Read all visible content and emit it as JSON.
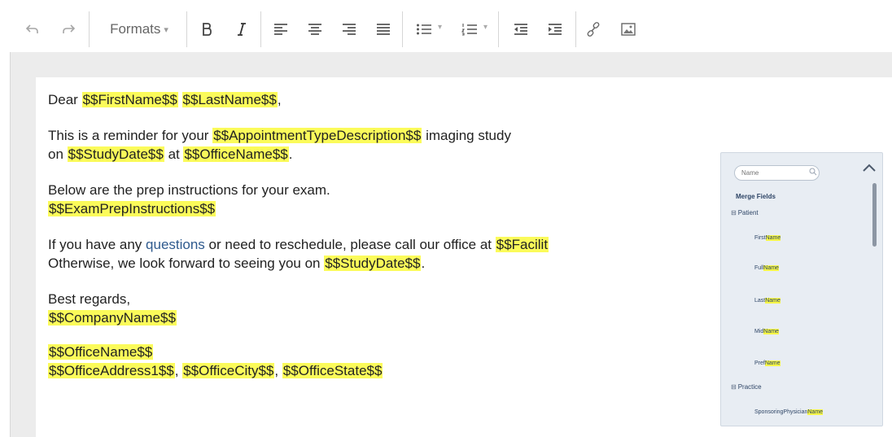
{
  "toolbar": {
    "formats_label": "Formats",
    "formats_arrow": "▾",
    "list_caret": "▾",
    "icons": [
      "undo-icon",
      "redo-icon",
      "bold-icon",
      "italic-icon",
      "align-left-icon",
      "align-center-icon",
      "align-right-icon",
      "align-justify-icon",
      "bullet-list-icon",
      "numbered-list-icon",
      "outdent-icon",
      "indent-icon",
      "link-icon",
      "image-icon"
    ]
  },
  "document": {
    "greeting": {
      "pre": "Dear ",
      "f1": "$$FirstName$$",
      "sp": " ",
      "f2": "$$LastName$$",
      "post": ","
    },
    "para1": {
      "pre": "This is a reminder for your ",
      "f1": "$$AppointmentTypeDescription$$",
      "post1": " imaging study",
      "line2_pre": "on ",
      "f2": "$$StudyDate$$",
      "mid": " at ",
      "f3": "$$OfficeName$$",
      "post2": "."
    },
    "para2": {
      "line1": "Below are the prep instructions for your exam.",
      "f1": "$$ExamPrepInstructions$$"
    },
    "para3": {
      "pre": "If you have any ",
      "blue1": "questions",
      "mid": " or need to reschedule, please call our office at ",
      "f1": "$$Facilit",
      "line2_pre": "Otherwise, we look forward to seeing you on ",
      "f2": "$$StudyDate$$",
      "post": "."
    },
    "para4": {
      "line1": "Best regards,",
      "f1": "$$CompanyName$$"
    },
    "para5": {
      "f1": "$$OfficeName$$",
      "f2": "$$OfficeAddress1$$",
      "sep1": ", ",
      "f3": "$$OfficeCity$$",
      "sep2": ", ",
      "f4": "$$OfficeState$$"
    }
  },
  "merge_panel": {
    "search_placeholder": "Name",
    "title": "Merge Fields",
    "groups": [
      {
        "toggle": "⊟",
        "label": "Patient"
      },
      {
        "toggle": "⊟",
        "label": "Practice"
      }
    ],
    "fields": [
      {
        "pre": "First",
        "mark": "Name"
      },
      {
        "pre": "Full",
        "mark": "Name"
      },
      {
        "pre": "Last",
        "mark": "Name"
      },
      {
        "pre": "Mid",
        "mark": "Name"
      },
      {
        "pre": "Pref",
        "mark": "Name"
      },
      {
        "pre": "SponsoringPhysician",
        "mark": "Name"
      }
    ]
  },
  "colors": {
    "highlight": "#fbfb5a",
    "link_text": "#2f5a8e",
    "panel_bg": "#e8edf3"
  }
}
